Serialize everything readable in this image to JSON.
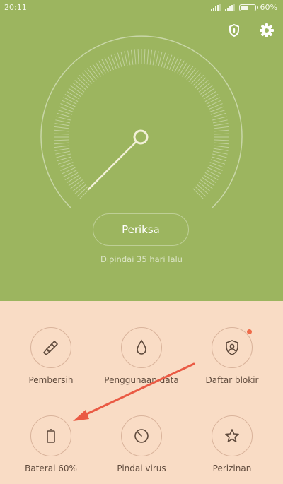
{
  "status_bar": {
    "time": "20:11",
    "battery_percent_text": "60%",
    "battery_level": 0.6
  },
  "header": {
    "icons": [
      "shield-icon",
      "gear-icon"
    ]
  },
  "scan": {
    "button_label": "Periksa",
    "last_scanned": "Dipindai 35 hari lalu"
  },
  "tools": [
    {
      "label": "Pembersih",
      "icon": "broom-icon"
    },
    {
      "label": "Penggunaan data",
      "icon": "drop-icon"
    },
    {
      "label": "Daftar blokir",
      "icon": "shield-user-icon",
      "badge": true
    },
    {
      "label": "Baterai 60%",
      "icon": "battery-icon"
    },
    {
      "label": "Pindai virus",
      "icon": "radar-icon"
    },
    {
      "label": "Perizinan",
      "icon": "star-icon"
    }
  ],
  "colors": {
    "top_bg": "#9cb55f",
    "bottom_bg": "#f9dcc5",
    "icon_stroke": "#5f4a3c",
    "badge": "#ef6b4a",
    "annotation_arrow": "#ea5a44"
  }
}
